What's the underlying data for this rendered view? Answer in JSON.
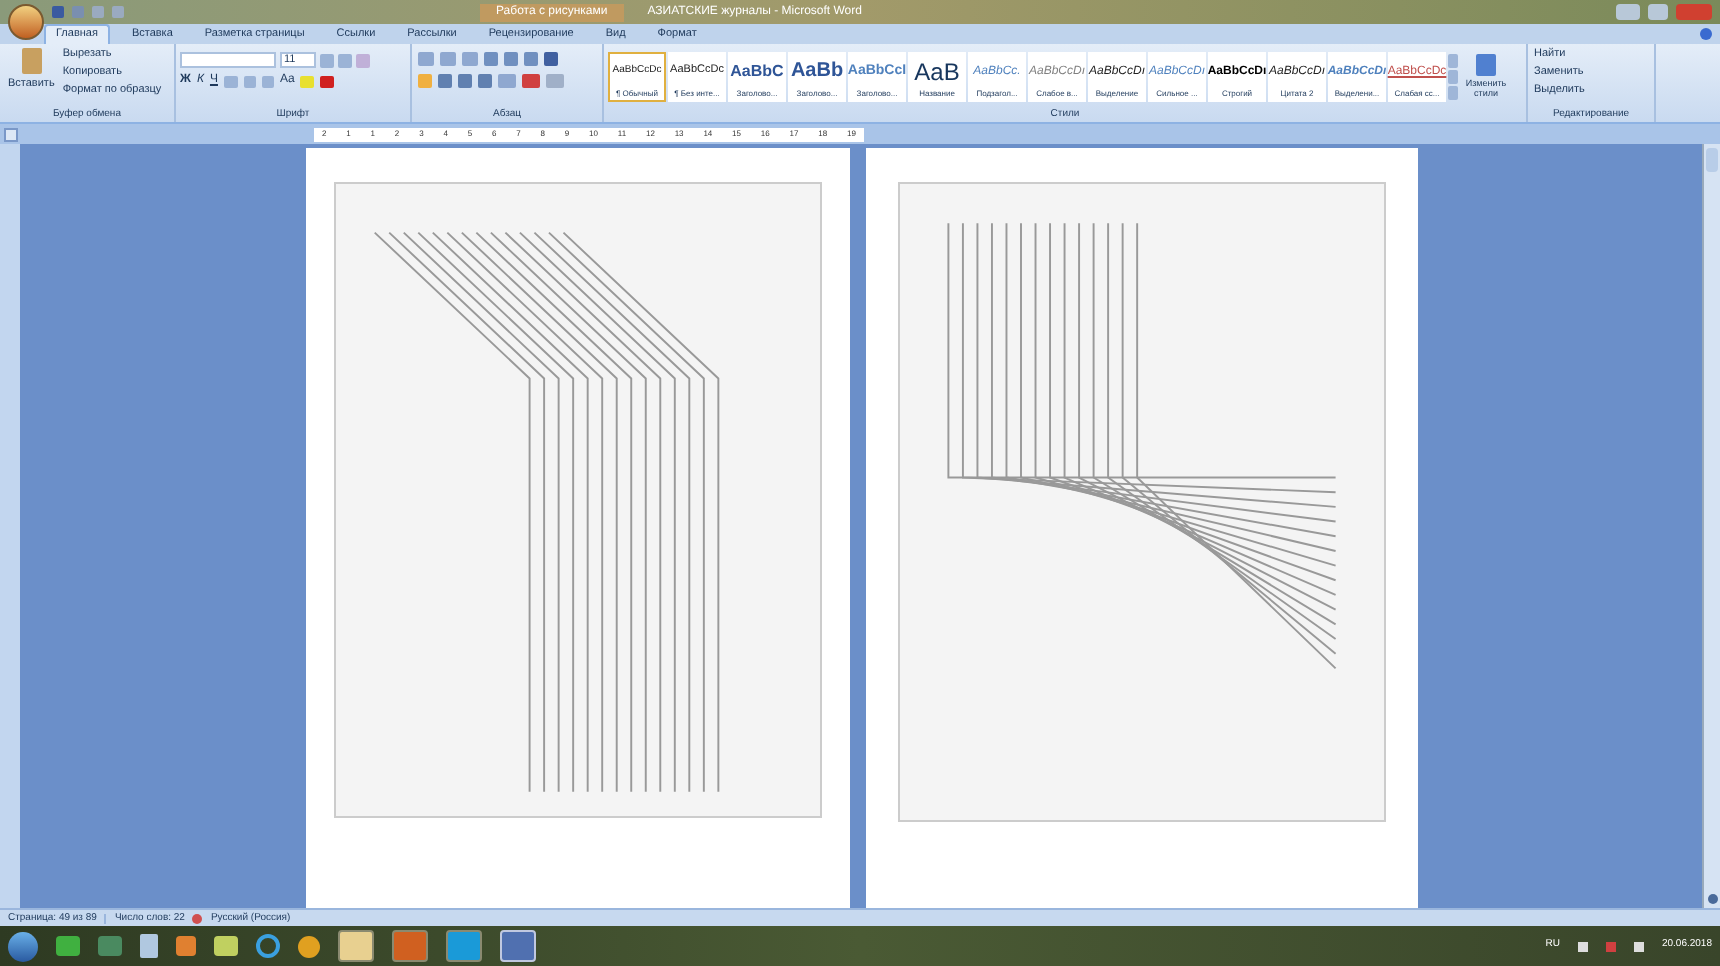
{
  "title_bar": {
    "context": "Работа с рисунками",
    "title": "АЗИАТСКИЕ журналы - Microsoft Word"
  },
  "tabs": [
    {
      "label": "Главная",
      "selected": true
    },
    {
      "label": "Вставка",
      "selected": false
    },
    {
      "label": "Разметка страницы",
      "selected": false
    },
    {
      "label": "Ссылки",
      "selected": false
    },
    {
      "label": "Рассылки",
      "selected": false
    },
    {
      "label": "Рецензирование",
      "selected": false
    },
    {
      "label": "Вид",
      "selected": false
    },
    {
      "label": "Формат",
      "selected": false
    }
  ],
  "clipboard": {
    "paste": "Вставить",
    "items": [
      "Вырезать",
      "Копировать",
      "Формат по образцу"
    ],
    "group": "Буфер обмена"
  },
  "font": {
    "size": "11",
    "format_buttons": [
      "Ж",
      "К",
      "Ч"
    ],
    "case_button": "Aa",
    "group": "Шрифт"
  },
  "paragraph": {
    "group": "Абзац"
  },
  "styles": {
    "items": [
      {
        "preview": "AaBbCcDc",
        "name": "¶ Обычный",
        "selected": true
      },
      {
        "preview": "AaBbCcDc",
        "name": "¶ Без инте...",
        "selected": false
      },
      {
        "preview": "AaBbC",
        "name": "Заголово...",
        "selected": false
      },
      {
        "preview": "AaBb",
        "name": "Заголово...",
        "selected": false
      },
      {
        "preview": "AaBbCcI",
        "name": "Заголово...",
        "selected": false
      },
      {
        "preview": "AaB",
        "name": "Название",
        "selected": false
      },
      {
        "preview": "AaBbCc.",
        "name": "Подзагол...",
        "selected": false
      },
      {
        "preview": "AaBbCcDı",
        "name": "Слабое в...",
        "selected": false
      },
      {
        "preview": "AaBbCcDı",
        "name": "Выделение",
        "selected": false
      },
      {
        "preview": "AaBbCcDı",
        "name": "Сильное ...",
        "selected": false
      },
      {
        "preview": "AaBbCcDı",
        "name": "Строгий",
        "selected": false
      },
      {
        "preview": "AaBbCcDı",
        "name": "Цитата 2",
        "selected": false
      },
      {
        "preview": "AaBbCcDı",
        "name": "Выделени...",
        "selected": false
      },
      {
        "preview": "AaBbCcDc",
        "name": "Слабая сс...",
        "selected": false
      }
    ],
    "change": "Изменить стили",
    "group": "Стили"
  },
  "editing": {
    "items": [
      "Найти",
      "Заменить",
      "Выделить"
    ],
    "group": "Редактирование"
  },
  "ruler": {
    "marks": [
      "2",
      "1",
      "1",
      "2",
      "3",
      "4",
      "5",
      "6",
      "7",
      "8",
      "9",
      "10",
      "11",
      "12",
      "13",
      "14",
      "15",
      "16",
      "17",
      "18",
      "19"
    ]
  },
  "status_bar": {
    "page": "Страница: 49 из 89",
    "words": "Число слов: 22",
    "language": "Русский (Россия)"
  },
  "tray": {
    "language": "RU",
    "date": "20.06.2018"
  }
}
